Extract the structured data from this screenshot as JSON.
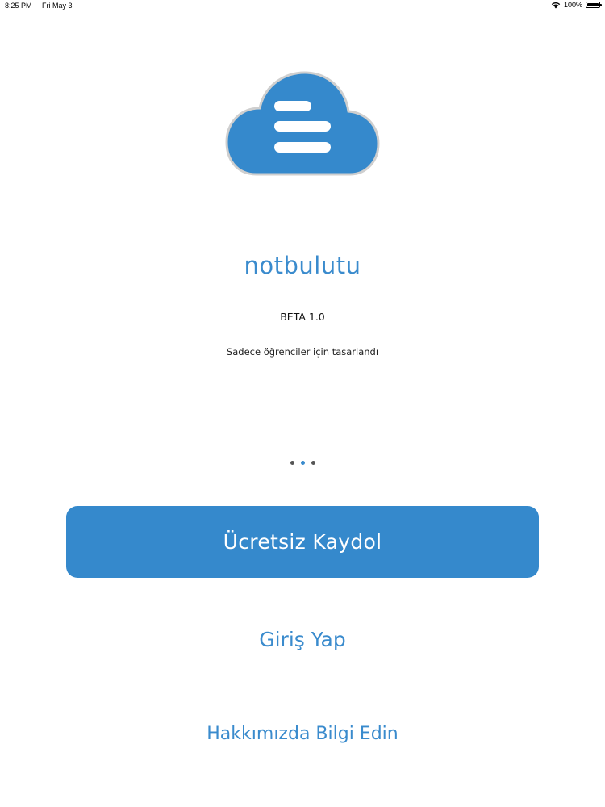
{
  "status_bar": {
    "time": "8:25 PM",
    "date": "Fri May 3",
    "battery": "100%",
    "wifi_icon": "wifi-icon",
    "battery_icon": "battery-icon",
    "battery_level": 1.0
  },
  "logo": {
    "icon": "cloud-notes-logo-icon",
    "color": "#3589cc"
  },
  "app": {
    "title": "notbulutu",
    "version": "BETA 1.0",
    "tagline": "Sadece öğrenciler için tasarlandı"
  },
  "pager": {
    "page_count": 3,
    "active_index": 1
  },
  "actions": {
    "signup_label": "Ücretsiz Kaydol",
    "login_label": "Giriş Yap",
    "about_label": "Hakkımızda Bilgi Edin"
  },
  "colors": {
    "accent": "#3589cc",
    "background": "#ffffff"
  }
}
